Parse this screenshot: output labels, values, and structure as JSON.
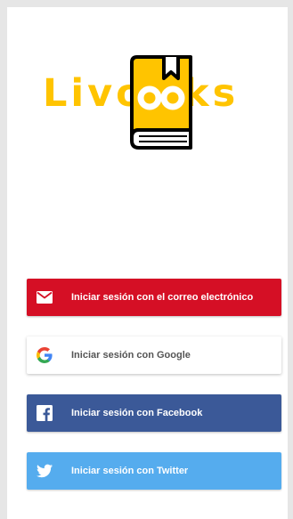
{
  "app": {
    "logo_text_left": "Livo",
    "logo_text_right": "ks",
    "logo_full_text": "Livooks"
  },
  "colors": {
    "logo_yellow": "#ffc400",
    "email_red": "#d50f25",
    "facebook_blue": "#3b5998",
    "twitter_blue": "#55acee",
    "google_text_gray": "#555555"
  },
  "login": {
    "email_label": "Iniciar sesión con el correo electrónico",
    "google_label": "Iniciar sesión con Google",
    "facebook_label": "Iniciar sesión con Facebook",
    "twitter_label": "Iniciar sesión con Twitter"
  },
  "icons": {
    "email": "envelope-icon",
    "google": "google-g-icon",
    "facebook": "facebook-f-icon",
    "twitter": "twitter-bird-icon",
    "logo": "book-bookmark-icon"
  }
}
